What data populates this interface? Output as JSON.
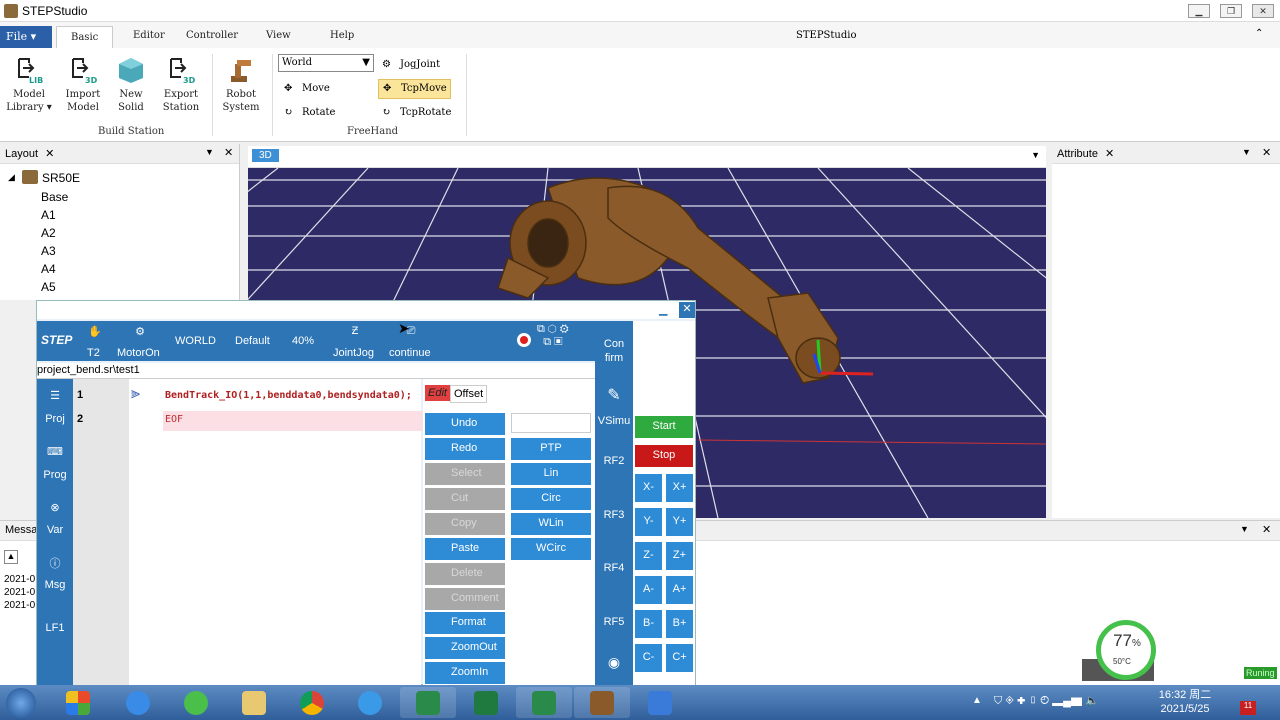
{
  "window": {
    "title": "STEPStudio",
    "ribbon_title": "STEPStudio"
  },
  "ribbon": {
    "file": "File",
    "tabs": [
      "Basic",
      "Editor",
      "Controller",
      "View",
      "Help"
    ],
    "build_station": {
      "label": "Build Station",
      "buttons": [
        "Model Library",
        "Import Model",
        "New Solid",
        "Export Station"
      ]
    },
    "robot_system": "Robot System",
    "freehand": {
      "label": "FreeHand",
      "coord_select": "World",
      "move": "Move",
      "rotate": "Rotate",
      "jog_joint": "JogJoint",
      "tcp_move": "TcpMove",
      "tcp_rotate": "TcpRotate"
    }
  },
  "layout_panel": {
    "title": "Layout",
    "root": "SR50E",
    "items": [
      "Base",
      "A1",
      "A2",
      "A3",
      "A4",
      "A5"
    ]
  },
  "viewport": {
    "tab": "3D"
  },
  "attribute_panel": {
    "title": "Attribute"
  },
  "message_panel": {
    "title": "Messa",
    "rows": [
      "2021-0",
      "2021-0",
      "2021-0"
    ],
    "status": "Runing"
  },
  "step_window": {
    "logo": "STEP",
    "toolbar": {
      "mode": "T2",
      "motor": "MotorOn",
      "coord": "WORLD",
      "tool": "Default",
      "speed": "40%",
      "jog": "JointJog",
      "run": "continue"
    },
    "path": "project_bend.sr\\test1",
    "left_nav": [
      "Proj",
      "Prog",
      "Var",
      "Msg",
      "LF1"
    ],
    "code": {
      "lines": [
        {
          "num": "1",
          "text": "BendTrack_IO(1,1,benddata0,bendsyndata0);"
        },
        {
          "num": "2",
          "text": "EOF"
        }
      ]
    },
    "edit_tabs": {
      "edit": "Edit",
      "offset": "Offset"
    },
    "edit_buttons": [
      "Undo",
      "Redo",
      "Select",
      "Cut",
      "Copy",
      "Paste",
      "Delete",
      "Comment",
      "Format",
      "ZoomOut",
      "ZoomIn"
    ],
    "motion_buttons": [
      "PTP",
      "Lin",
      "Circ",
      "WLin",
      "WCirc"
    ],
    "right_strip": [
      "Con firm",
      "VSimu",
      "RF2",
      "RF3",
      "RF4",
      "RF5"
    ],
    "run_controls": {
      "start": "Start",
      "stop": "Stop"
    },
    "jog_buttons": [
      [
        "X-",
        "X+"
      ],
      [
        "Y-",
        "Y+"
      ],
      [
        "Z-",
        "Z+"
      ],
      [
        "A-",
        "A+"
      ],
      [
        "B-",
        "B+"
      ],
      [
        "C-",
        "C+"
      ]
    ]
  },
  "gauge": {
    "percent": "77",
    "percent_sign": "%",
    "temp": "50°C"
  },
  "taskbar": {
    "time": "16:32 周二",
    "date": "2021/5/25"
  }
}
